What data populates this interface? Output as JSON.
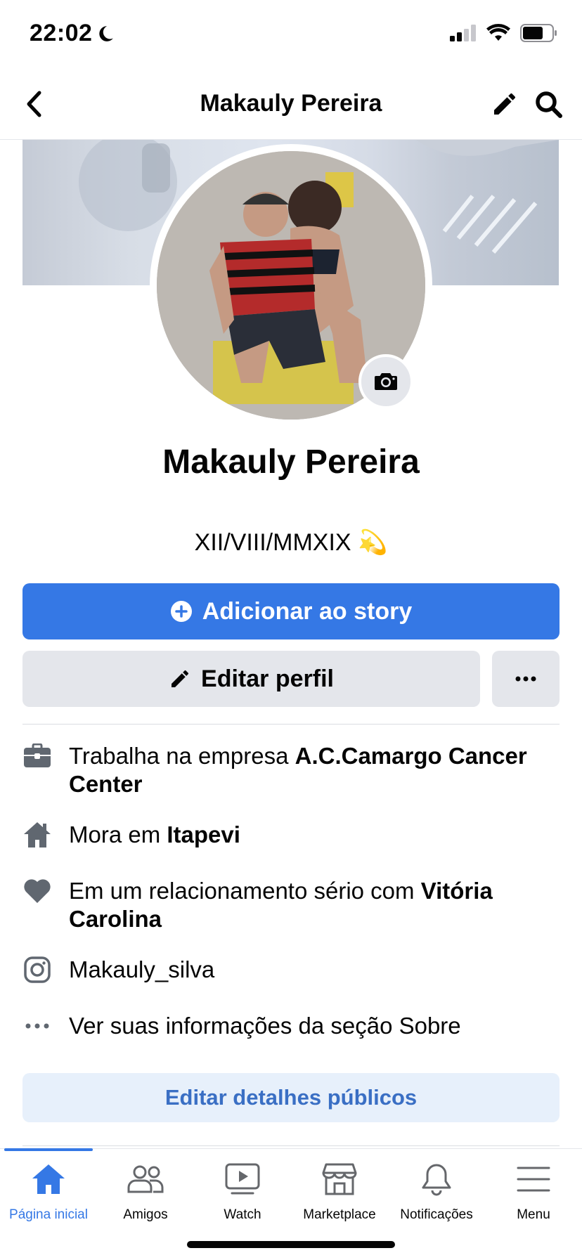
{
  "status_bar": {
    "time": "22:02"
  },
  "header": {
    "title": "Makauly Pereira"
  },
  "profile": {
    "name": "Makauly Pereira",
    "bio": "XII/VIII/MMXIX 💫"
  },
  "actions": {
    "add_story": "Adicionar ao story",
    "edit_profile": "Editar perfil"
  },
  "info": {
    "work_prefix": "Trabalha na empresa ",
    "work_company": "A.C.Camargo Cancer Center",
    "lives_prefix": "Mora em ",
    "lives_city": "Itapevi",
    "relationship_prefix": "Em um relacionamento sério com ",
    "relationship_partner": "Vitória Carolina",
    "instagram": "Makauly_silva",
    "see_about": "Ver suas informações da seção Sobre"
  },
  "edit_public_details": "Editar detalhes públicos",
  "colors": {
    "accent": "#3578e5",
    "button_gray": "#e4e6eb",
    "light_blue": "#e7f0fb"
  },
  "tabs": [
    {
      "label": "Página inicial",
      "icon": "home-icon",
      "active": true
    },
    {
      "label": "Amigos",
      "icon": "friends-icon"
    },
    {
      "label": "Watch",
      "icon": "watch-icon"
    },
    {
      "label": "Marketplace",
      "icon": "marketplace-icon"
    },
    {
      "label": "Notificações",
      "icon": "bell-icon"
    },
    {
      "label": "Menu",
      "icon": "menu-icon"
    }
  ]
}
